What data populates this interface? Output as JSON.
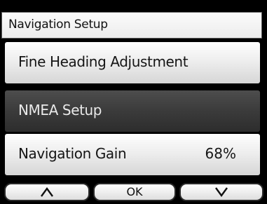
{
  "header": {
    "title": "Navigation Setup"
  },
  "menu": {
    "items": [
      {
        "label": "Fine Heading Adjustment",
        "value": "",
        "selected": false
      },
      {
        "label": "NMEA Setup",
        "value": "",
        "selected": true
      },
      {
        "label": "Navigation Gain",
        "value": "68%",
        "selected": false
      }
    ]
  },
  "softkeys": {
    "up_icon": "up-arrow-icon",
    "ok_label": "OK",
    "down_icon": "down-arrow-icon"
  },
  "colors": {
    "selected_background": "#3b3b3b",
    "normal_background": "#eeeeee",
    "frame": "#000000"
  }
}
